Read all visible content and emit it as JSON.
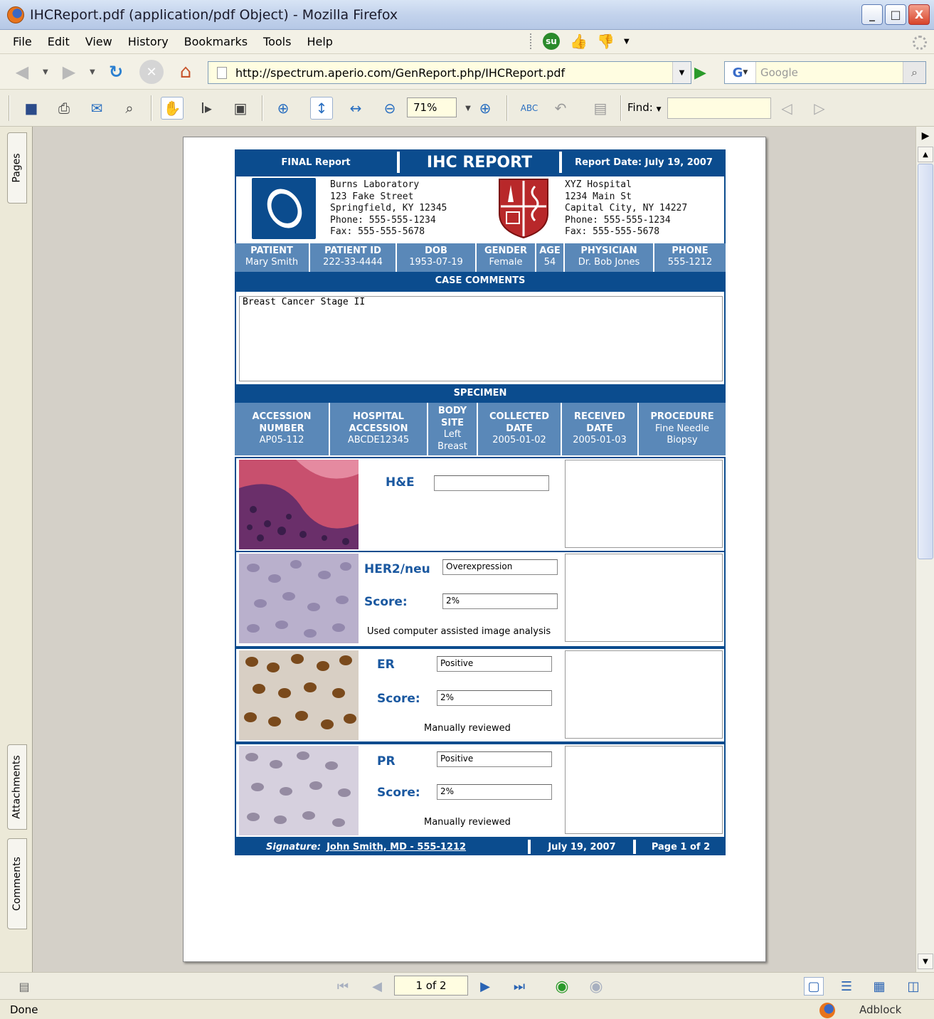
{
  "window": {
    "title": "IHCReport.pdf (application/pdf Object) - Mozilla Firefox",
    "minimize": "_",
    "maximize": "□",
    "close": "X"
  },
  "menu": [
    "File",
    "Edit",
    "View",
    "History",
    "Bookmarks",
    "Tools",
    "Help"
  ],
  "nav": {
    "url": "http://spectrum.aperio.com/GenReport.php/IHCReport.pdf",
    "search_placeholder": "Google",
    "search_engine": "G"
  },
  "pdf_toolbar": {
    "zoom": "71%",
    "find_label": "Find:"
  },
  "sidebar_tabs": {
    "pages": "Pages",
    "attachments": "Attachments",
    "comments": "Comments"
  },
  "report": {
    "header": {
      "left": "FINAL Report",
      "title": "IHC REPORT",
      "right": "Report Date: July 19, 2007"
    },
    "lab": [
      "Burns Laboratory",
      "123 Fake Street",
      "Springfield, KY 12345",
      "Phone: 555-555-1234",
      "Fax: 555-555-5678"
    ],
    "hospital": [
      "XYZ Hospital",
      "1234 Main St",
      "Capital City, NY 14227",
      "Phone: 555-555-1234",
      "Fax: 555-555-5678"
    ],
    "patient": [
      {
        "key": "PATIENT",
        "value": "Mary Smith"
      },
      {
        "key": "PATIENT ID",
        "value": "222-33-4444"
      },
      {
        "key": "DOB",
        "value": "1953-07-19"
      },
      {
        "key": "GENDER",
        "value": "Female"
      },
      {
        "key": "AGE",
        "value": "54"
      },
      {
        "key": "PHYSICIAN",
        "value": "Dr. Bob Jones"
      },
      {
        "key": "PHONE",
        "value": "555-1212"
      }
    ],
    "case_comments_heading": "CASE COMMENTS",
    "case_comments": "Breast Cancer Stage II",
    "specimen_heading": "SPECIMEN",
    "specimen": {
      "accession_key": [
        "ACCESSION",
        "NUMBER"
      ],
      "accession_value": "AP05-112",
      "hosp_key": [
        "HOSPITAL",
        "ACCESSION"
      ],
      "hosp_value": "ABCDE12345",
      "body_key": [
        "BODY",
        "SITE"
      ],
      "body_value": [
        "Left",
        "Breast"
      ],
      "collected_key": [
        "COLLECTED",
        "DATE"
      ],
      "collected_value": "2005-01-02",
      "received_key": [
        "RECEIVED",
        "DATE"
      ],
      "received_value": "2005-01-03",
      "procedure_key": "PROCEDURE",
      "procedure_value": [
        "Fine Needle",
        "Biopsy"
      ]
    },
    "stains": [
      {
        "name": "H&E",
        "result": "",
        "score_label": "",
        "score": "",
        "note": ""
      },
      {
        "name": "HER2/neu",
        "result": "Overexpression",
        "score_label": "Score:",
        "score": "2%",
        "note": "Used computer assisted image analysis"
      },
      {
        "name": "ER",
        "result": "Positive",
        "score_label": "Score:",
        "score": "2%",
        "note": "Manually reviewed"
      },
      {
        "name": "PR",
        "result": "Positive",
        "score_label": "Score:",
        "score": "2%",
        "note": "Manually reviewed"
      }
    ],
    "footer": {
      "signature_label": "Signature:",
      "signature": "John Smith, MD - 555-1212",
      "date": "July 19, 2007",
      "page": "Page 1 of 2"
    }
  },
  "page_nav": {
    "page_field": "1 of 2"
  },
  "status": {
    "text": "Done",
    "adblock": "Adblock"
  },
  "colors": {
    "navy": "#0b4c8e",
    "steel": "#5a88b8"
  }
}
